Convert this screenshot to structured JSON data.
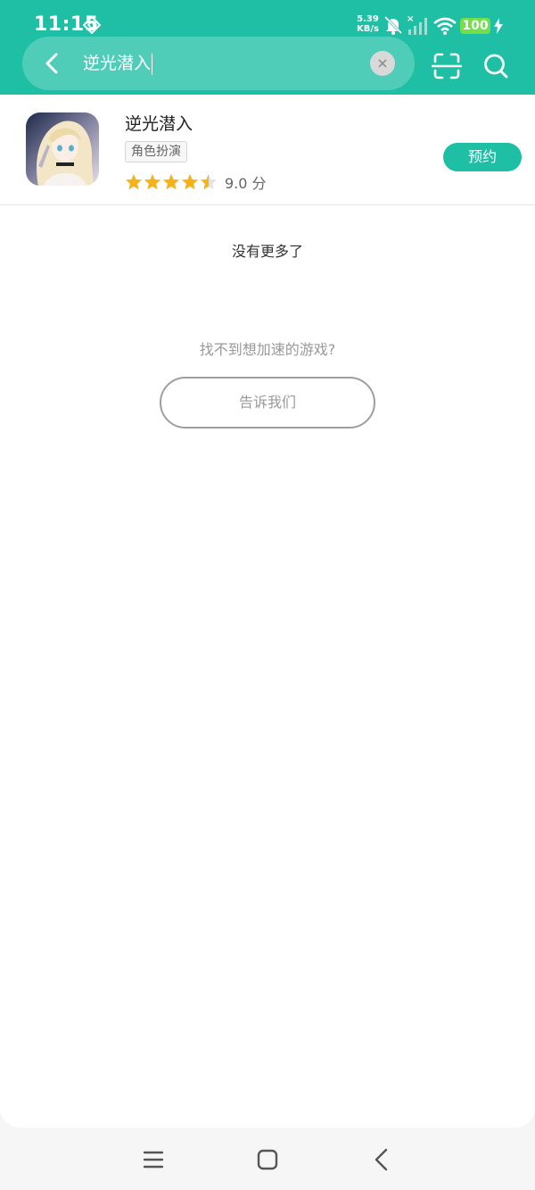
{
  "status_bar": {
    "time": "11:15",
    "net_speed_value": "5.39",
    "net_speed_unit": "KB/s",
    "battery": "100",
    "icons": [
      "diamond-notification-icon",
      "bell-muted-icon",
      "signal-icon",
      "wifi-icon",
      "charging-bolt-icon"
    ]
  },
  "header": {
    "search_query": "逆光潜入",
    "icons": [
      "back-arrow-icon",
      "clear-icon",
      "scan-icon",
      "search-icon"
    ]
  },
  "results": [
    {
      "title": "逆光潜入",
      "tag": "角色扮演",
      "rating_stars": 4.5,
      "score": "9.0 分",
      "action_label": "预约"
    }
  ],
  "footer": {
    "no_more": "没有更多了",
    "hint": "找不到想加速的游戏?",
    "feedback_button": "告诉我们"
  },
  "nav_bar": {
    "icons": [
      "menu-icon",
      "home-icon",
      "back-icon"
    ]
  },
  "colors": {
    "primary": "#1ebfa4",
    "star": "#f6b21b",
    "battery": "#6fe04a"
  }
}
